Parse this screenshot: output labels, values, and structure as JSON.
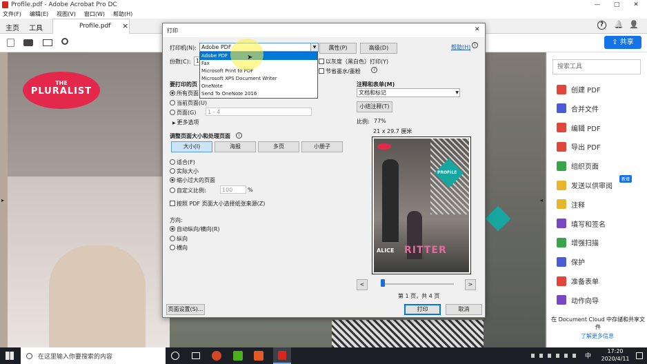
{
  "window": {
    "title": "Profile.pdf - Adobe Acrobat Pro DC",
    "minimize": "—",
    "maximize": "▢",
    "close": "✕"
  },
  "menu": [
    "文件(F)",
    "编辑(E)",
    "视图(V)",
    "窗口(W)",
    "帮助(H)"
  ],
  "tabs": {
    "home": "主页",
    "tools": "工具",
    "doc": "Profile.pdf",
    "close": "×"
  },
  "header_right": {
    "help": "?",
    "bell": "🔔",
    "user": "👤",
    "share": "共享"
  },
  "doc_page": {
    "logo_line1": "THE",
    "logo_line2": "PLURALIST"
  },
  "right_pane": {
    "search_placeholder": "搜索工具",
    "tools": [
      {
        "label": "创建 PDF",
        "color": "#e0463a"
      },
      {
        "label": "合并文件",
        "color": "#4b5bd6"
      },
      {
        "label": "编辑 PDF",
        "color": "#e0463a"
      },
      {
        "label": "导出 PDF",
        "color": "#e0463a"
      },
      {
        "label": "组织页面",
        "color": "#3aa44a"
      },
      {
        "label": "发送以供审阅",
        "color": "#e8b52e",
        "badge": "新增"
      },
      {
        "label": "注释",
        "color": "#e8b52e"
      },
      {
        "label": "填写和签名",
        "color": "#7a48c4"
      },
      {
        "label": "增强扫描",
        "color": "#3aa44a"
      },
      {
        "label": "保护",
        "color": "#4b5bd6"
      },
      {
        "label": "准备表单",
        "color": "#e0463a"
      },
      {
        "label": "动作向导",
        "color": "#7a48c4"
      }
    ],
    "cloud_text": "在 Document Cloud 中存储和共享文件",
    "more_link": "了解更多信息"
  },
  "dialog": {
    "title": "打印",
    "close": "✕",
    "printer_label": "打印机(N):",
    "printer_value": "Adobe PDF",
    "printer_options": [
      "Adobe PDF",
      "Fax",
      "Microsoft Print to PDF",
      "Microsoft XPS Document Writer",
      "OneNote",
      "Send To OneNote 2016"
    ],
    "properties": "属性(P)",
    "advanced": "高级(D)",
    "help": "帮助(H)",
    "copies_label": "份数(C):",
    "copies_value": "1",
    "grayscale": "以灰度（黑白色）打印(Y)",
    "save_ink": "节省墨水/墨粉",
    "pages_section": "要打印的页",
    "all_pages": "所有页面",
    "current_page": "当前页面(U)",
    "pages": "页面(G)",
    "pages_value": "1 - 4",
    "more_options": "更多选项",
    "size_section": "调整页面大小和处理页面",
    "size_buttons": [
      "大小(I)",
      "海报",
      "多页",
      "小册子"
    ],
    "fit": "适合(F)",
    "actual_size": "实际大小",
    "shrink": "缩小过大的页面",
    "custom_scale": "自定义比例:",
    "custom_value": "100",
    "percent": "%",
    "paper_source": "按照 PDF 页面大小选择纸张来源(Z)",
    "orientation_section": "方向:",
    "auto_orient": "自动纵向/横向(R)",
    "portrait": "纵向",
    "landscape": "横向",
    "comments_section": "注释和表单(M)",
    "comments_value": "文档和标记",
    "summarize": "小结注释(T)",
    "scale_label": "比例:",
    "scale_value": "77%",
    "paper_size": "21 x 29.7 厘米",
    "preview": {
      "alice": "ALICE",
      "ritter": "RITTER",
      "profile": "PROFILE"
    },
    "page_indicator": "第 1 页，共 4 页",
    "prev": "<",
    "next": ">",
    "page_setup": "页面设置(S)...",
    "print": "打印",
    "cancel": "取消"
  },
  "taskbar": {
    "search": "在这里输入你要搜索的内容",
    "time": "17:20",
    "date": "2020/4/11",
    "ime": "中"
  }
}
